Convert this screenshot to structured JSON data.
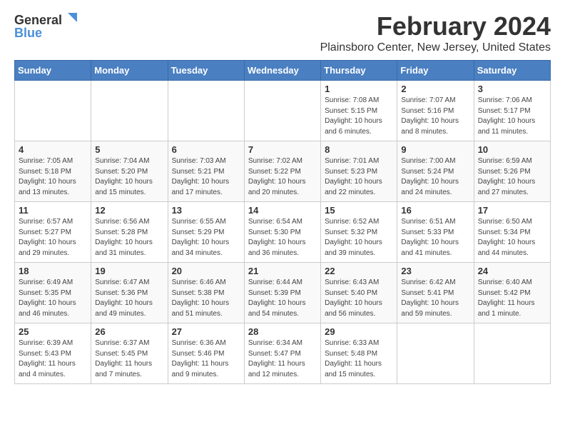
{
  "logo": {
    "text_general": "General",
    "text_blue": "Blue"
  },
  "title": "February 2024",
  "location": "Plainsboro Center, New Jersey, United States",
  "days_of_week": [
    "Sunday",
    "Monday",
    "Tuesday",
    "Wednesday",
    "Thursday",
    "Friday",
    "Saturday"
  ],
  "weeks": [
    [
      {
        "day": "",
        "info": ""
      },
      {
        "day": "",
        "info": ""
      },
      {
        "day": "",
        "info": ""
      },
      {
        "day": "",
        "info": ""
      },
      {
        "day": "1",
        "info": "Sunrise: 7:08 AM\nSunset: 5:15 PM\nDaylight: 10 hours\nand 6 minutes."
      },
      {
        "day": "2",
        "info": "Sunrise: 7:07 AM\nSunset: 5:16 PM\nDaylight: 10 hours\nand 8 minutes."
      },
      {
        "day": "3",
        "info": "Sunrise: 7:06 AM\nSunset: 5:17 PM\nDaylight: 10 hours\nand 11 minutes."
      }
    ],
    [
      {
        "day": "4",
        "info": "Sunrise: 7:05 AM\nSunset: 5:18 PM\nDaylight: 10 hours\nand 13 minutes."
      },
      {
        "day": "5",
        "info": "Sunrise: 7:04 AM\nSunset: 5:20 PM\nDaylight: 10 hours\nand 15 minutes."
      },
      {
        "day": "6",
        "info": "Sunrise: 7:03 AM\nSunset: 5:21 PM\nDaylight: 10 hours\nand 17 minutes."
      },
      {
        "day": "7",
        "info": "Sunrise: 7:02 AM\nSunset: 5:22 PM\nDaylight: 10 hours\nand 20 minutes."
      },
      {
        "day": "8",
        "info": "Sunrise: 7:01 AM\nSunset: 5:23 PM\nDaylight: 10 hours\nand 22 minutes."
      },
      {
        "day": "9",
        "info": "Sunrise: 7:00 AM\nSunset: 5:24 PM\nDaylight: 10 hours\nand 24 minutes."
      },
      {
        "day": "10",
        "info": "Sunrise: 6:59 AM\nSunset: 5:26 PM\nDaylight: 10 hours\nand 27 minutes."
      }
    ],
    [
      {
        "day": "11",
        "info": "Sunrise: 6:57 AM\nSunset: 5:27 PM\nDaylight: 10 hours\nand 29 minutes."
      },
      {
        "day": "12",
        "info": "Sunrise: 6:56 AM\nSunset: 5:28 PM\nDaylight: 10 hours\nand 31 minutes."
      },
      {
        "day": "13",
        "info": "Sunrise: 6:55 AM\nSunset: 5:29 PM\nDaylight: 10 hours\nand 34 minutes."
      },
      {
        "day": "14",
        "info": "Sunrise: 6:54 AM\nSunset: 5:30 PM\nDaylight: 10 hours\nand 36 minutes."
      },
      {
        "day": "15",
        "info": "Sunrise: 6:52 AM\nSunset: 5:32 PM\nDaylight: 10 hours\nand 39 minutes."
      },
      {
        "day": "16",
        "info": "Sunrise: 6:51 AM\nSunset: 5:33 PM\nDaylight: 10 hours\nand 41 minutes."
      },
      {
        "day": "17",
        "info": "Sunrise: 6:50 AM\nSunset: 5:34 PM\nDaylight: 10 hours\nand 44 minutes."
      }
    ],
    [
      {
        "day": "18",
        "info": "Sunrise: 6:49 AM\nSunset: 5:35 PM\nDaylight: 10 hours\nand 46 minutes."
      },
      {
        "day": "19",
        "info": "Sunrise: 6:47 AM\nSunset: 5:36 PM\nDaylight: 10 hours\nand 49 minutes."
      },
      {
        "day": "20",
        "info": "Sunrise: 6:46 AM\nSunset: 5:38 PM\nDaylight: 10 hours\nand 51 minutes."
      },
      {
        "day": "21",
        "info": "Sunrise: 6:44 AM\nSunset: 5:39 PM\nDaylight: 10 hours\nand 54 minutes."
      },
      {
        "day": "22",
        "info": "Sunrise: 6:43 AM\nSunset: 5:40 PM\nDaylight: 10 hours\nand 56 minutes."
      },
      {
        "day": "23",
        "info": "Sunrise: 6:42 AM\nSunset: 5:41 PM\nDaylight: 10 hours\nand 59 minutes."
      },
      {
        "day": "24",
        "info": "Sunrise: 6:40 AM\nSunset: 5:42 PM\nDaylight: 11 hours\nand 1 minute."
      }
    ],
    [
      {
        "day": "25",
        "info": "Sunrise: 6:39 AM\nSunset: 5:43 PM\nDaylight: 11 hours\nand 4 minutes."
      },
      {
        "day": "26",
        "info": "Sunrise: 6:37 AM\nSunset: 5:45 PM\nDaylight: 11 hours\nand 7 minutes."
      },
      {
        "day": "27",
        "info": "Sunrise: 6:36 AM\nSunset: 5:46 PM\nDaylight: 11 hours\nand 9 minutes."
      },
      {
        "day": "28",
        "info": "Sunrise: 6:34 AM\nSunset: 5:47 PM\nDaylight: 11 hours\nand 12 minutes."
      },
      {
        "day": "29",
        "info": "Sunrise: 6:33 AM\nSunset: 5:48 PM\nDaylight: 11 hours\nand 15 minutes."
      },
      {
        "day": "",
        "info": ""
      },
      {
        "day": "",
        "info": ""
      }
    ]
  ]
}
